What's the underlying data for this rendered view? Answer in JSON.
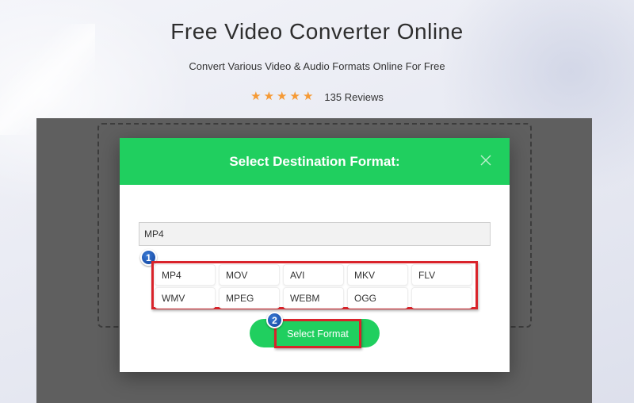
{
  "hero": {
    "title": "Free Video Converter Online",
    "subtitle": "Convert Various Video & Audio Formats Online For Free",
    "rating": {
      "stars": 5,
      "reviews_text": "135 Reviews"
    }
  },
  "modal": {
    "title": "Select Destination Format:",
    "search_value": "MP4",
    "formats_row1": [
      "MP4",
      "MOV",
      "AVI",
      "MKV",
      "FLV"
    ],
    "formats_row2": [
      "WMV",
      "MPEG",
      "WEBM",
      "OGG",
      ""
    ],
    "select_button_label": "Select Format",
    "callouts": [
      "1",
      "2"
    ]
  },
  "colors": {
    "header_green": "#20cf5f",
    "highlight_red": "#d9232a",
    "star_orange": "#f59a35",
    "callout_blue": "#0e3f9a"
  },
  "icons": [
    "star-icon",
    "close-icon"
  ]
}
